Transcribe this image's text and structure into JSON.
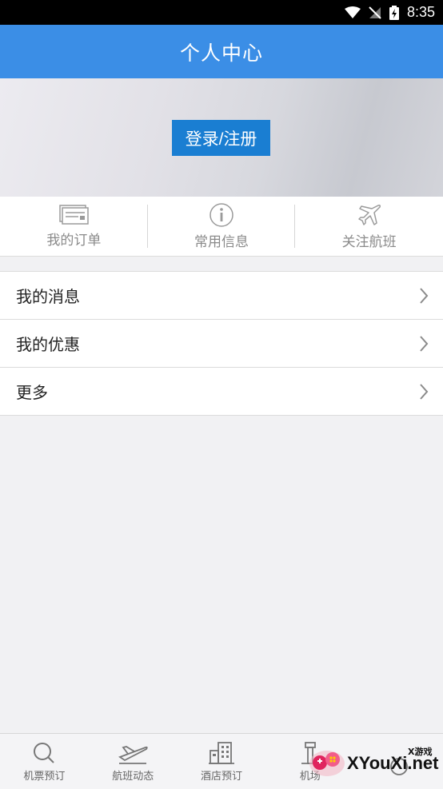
{
  "status_bar": {
    "time": "8:35"
  },
  "header": {
    "title": "个人中心"
  },
  "banner": {
    "login_label": "登录/注册"
  },
  "quick_actions": [
    {
      "label": "我的订单",
      "icon": "order-icon"
    },
    {
      "label": "常用信息",
      "icon": "info-icon"
    },
    {
      "label": "关注航班",
      "icon": "plane-icon"
    }
  ],
  "menu": [
    {
      "label": "我的消息"
    },
    {
      "label": "我的优惠"
    },
    {
      "label": "更多"
    }
  ],
  "tabbar": [
    {
      "label": "机票预订",
      "icon": "search-icon"
    },
    {
      "label": "航班动态",
      "icon": "takeoff-icon"
    },
    {
      "label": "酒店预订",
      "icon": "hotel-icon"
    },
    {
      "label": "机场",
      "icon": "airport-icon"
    },
    {
      "label": "",
      "icon": "more-icon"
    }
  ],
  "watermark": {
    "brand": "XYouXi.net",
    "tagline": "X游戏"
  },
  "colors": {
    "primary": "#3b8ee6",
    "button": "#1a7ed2"
  }
}
